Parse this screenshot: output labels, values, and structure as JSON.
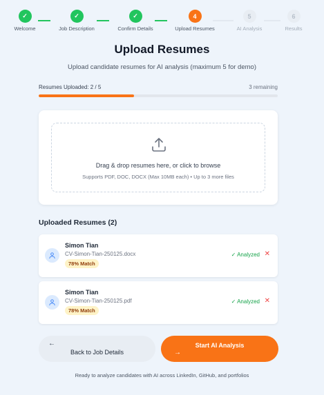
{
  "stepper": {
    "steps": [
      {
        "mark": "✓",
        "label": "Welcome",
        "state": "done"
      },
      {
        "mark": "✓",
        "label": "Job Description",
        "state": "done"
      },
      {
        "mark": "✓",
        "label": "Confirm Details",
        "state": "done"
      },
      {
        "mark": "4",
        "label": "Upload Resumes",
        "state": "active"
      },
      {
        "mark": "5",
        "label": "AI Analysis",
        "state": "todo"
      },
      {
        "mark": "6",
        "label": "Results",
        "state": "todo"
      }
    ]
  },
  "header": {
    "title": "Upload Resumes",
    "subtitle": "Upload candidate resumes for AI analysis (maximum 5 for demo)"
  },
  "progress": {
    "label": "Resumes Uploaded: 2 / 5",
    "remaining": "3 remaining",
    "fraction": 0.4,
    "color": "#f97316"
  },
  "dropzone": {
    "icon": "upload-icon",
    "title": "Drag & drop resumes here, or click to browse",
    "subtitle": "Supports PDF, DOC, DOCX (Max 10MB each) • Up to 3 more files"
  },
  "uploaded": {
    "heading": "Uploaded Resumes (2)",
    "items": [
      {
        "name": "Simon Tian",
        "file": "CV-Simon-Tian-250125.docx",
        "match": "78% Match",
        "status": "✓ Analyzed",
        "remove": "✕"
      },
      {
        "name": "Simon Tian",
        "file": "CV-Simon-Tian-250125.pdf",
        "match": "78% Match",
        "status": "✓ Analyzed",
        "remove": "✕"
      }
    ]
  },
  "actions": {
    "back_arrow": "←",
    "back_label": "Back to Job Details",
    "start_label": "Start AI Analysis",
    "start_arrow": "→"
  },
  "footer": {
    "text": "Ready to analyze candidates with AI across LinkedIn, GitHub, and portfolios"
  }
}
